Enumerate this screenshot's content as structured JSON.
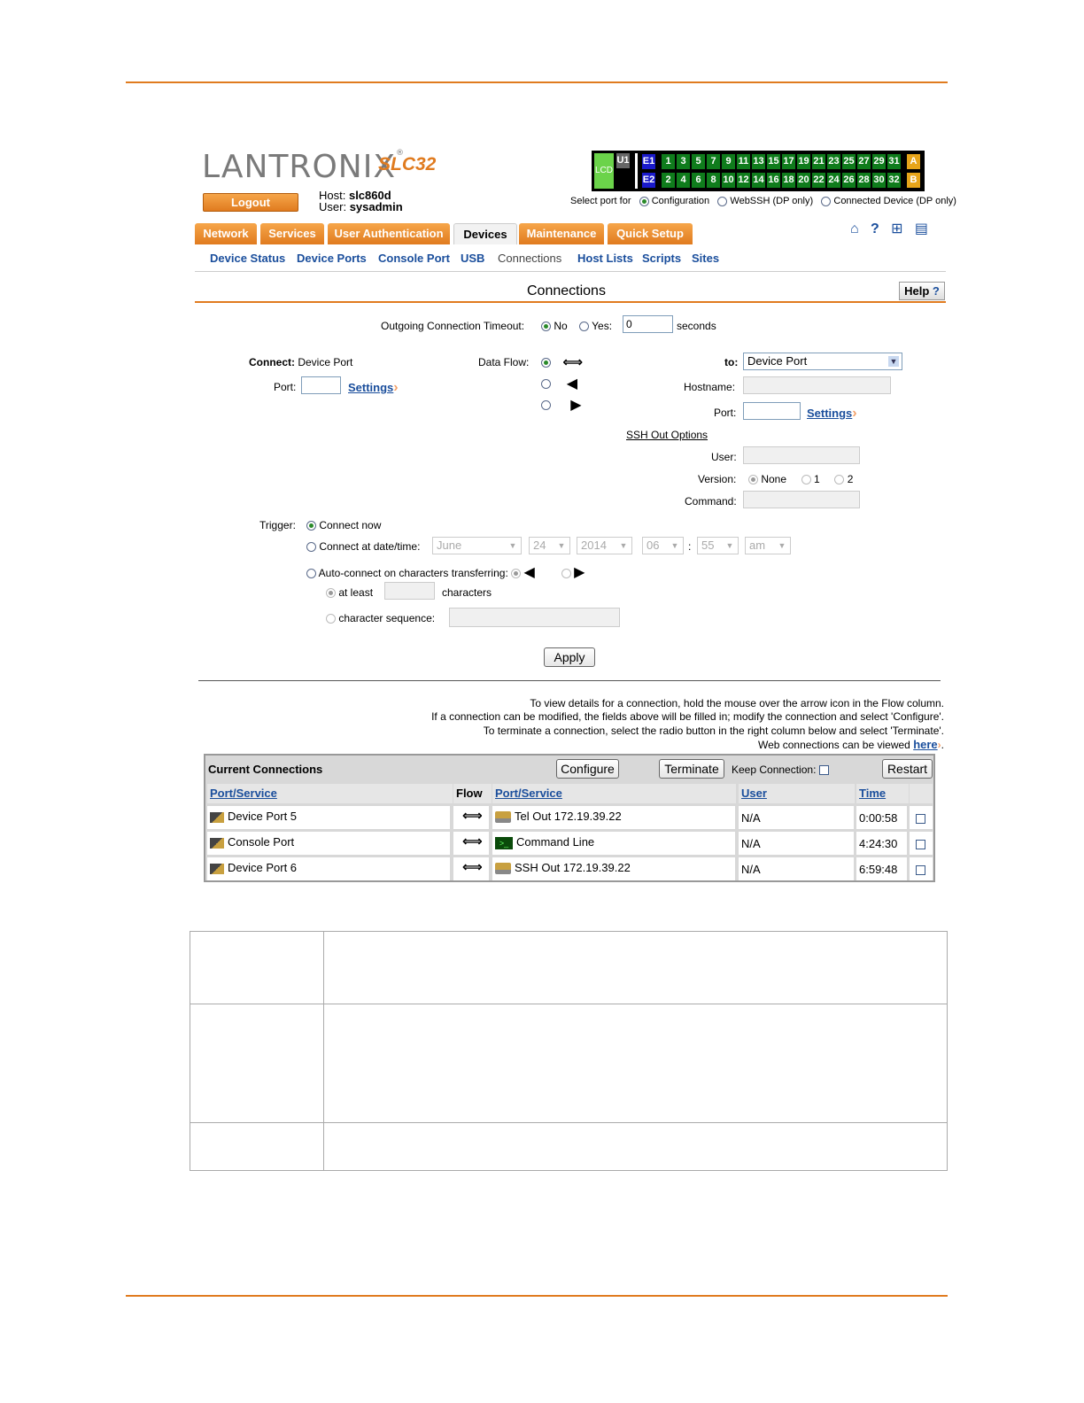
{
  "brand": {
    "logo_text": "LANTRONIX",
    "model": "SLC32"
  },
  "header": {
    "logout_label": "Logout",
    "host_label": "Host:",
    "host_value": "slc860d",
    "user_label": "User:",
    "user_value": "sysadmin",
    "select_port_label": "Select port for",
    "port_modes": [
      "Configuration",
      "WebSSH (DP only)",
      "Connected Device (DP only)"
    ],
    "lcd": "LCD",
    "u1": "U1",
    "e1": "E1",
    "e2": "E2",
    "a": "A",
    "b": "B",
    "ports_top": [
      "1",
      "3",
      "5",
      "7",
      "9",
      "11",
      "13",
      "15",
      "17",
      "19",
      "21",
      "23",
      "25",
      "27",
      "29",
      "31"
    ],
    "ports_bottom": [
      "2",
      "4",
      "6",
      "8",
      "10",
      "12",
      "14",
      "16",
      "18",
      "20",
      "22",
      "24",
      "26",
      "28",
      "30",
      "32"
    ]
  },
  "tabs": [
    "Network",
    "Services",
    "User Authentication",
    "Devices",
    "Maintenance",
    "Quick Setup"
  ],
  "subnav": [
    "Device Status",
    "Device Ports",
    "Console Port",
    "USB",
    "Connections",
    "Host Lists",
    "Scripts",
    "Sites"
  ],
  "page": {
    "title": "Connections",
    "help": "Help"
  },
  "form": {
    "timeout_label": "Outgoing Connection Timeout:",
    "no": "No",
    "yes": "Yes:",
    "timeout_value": "0",
    "seconds": "seconds",
    "connect_label": "Connect:",
    "connect_value": "Device Port",
    "port_label": "Port:",
    "settings": "Settings",
    "dataflow_label": "Data Flow:",
    "to_label": "to:",
    "to_value": "Device Port",
    "hostname_label": "Hostname:",
    "port2_label": "Port:",
    "ssh_out": "SSH Out Options",
    "user_label": "User:",
    "version_label": "Version:",
    "v_none": "None",
    "v_1": "1",
    "v_2": "2",
    "command_label": "Command:",
    "trigger_label": "Trigger:",
    "connect_now": "Connect now",
    "connect_at": "Connect at date/time:",
    "month": "June",
    "day": "24",
    "year": "2014",
    "hour": "06",
    "colon": ":",
    "minute": "55",
    "ampm": "am",
    "auto_connect": "Auto-connect on characters transferring:",
    "at_least": "at least",
    "characters": "characters",
    "char_seq": "character sequence:",
    "apply": "Apply"
  },
  "info": {
    "line1": "To view details for a connection, hold the mouse over the arrow icon in the Flow column.",
    "line2": "If a connection can be modified, the fields above will be filled in; modify the connection and select 'Configure'.",
    "line3": "To terminate a connection, select the radio button in the right column below and select 'Terminate'.",
    "line4": "Web connections can be viewed",
    "here": "here"
  },
  "connections": {
    "title": "Current Connections",
    "configure": "Configure",
    "terminate": "Terminate",
    "keep": "Keep Connection:",
    "restart": "Restart",
    "headers": [
      "Port/Service",
      "Flow",
      "Port/Service",
      "User",
      "Time"
    ],
    "rows": [
      {
        "from": "Device Port 5",
        "to": "Tel Out 172.19.39.22",
        "user": "N/A",
        "time": "0:00:58"
      },
      {
        "from": "Console Port",
        "to": "Command Line",
        "user": "N/A",
        "time": "4:24:30"
      },
      {
        "from": "Device Port 6",
        "to": "SSH Out 172.19.39.22",
        "user": "N/A",
        "time": "6:59:48"
      }
    ]
  }
}
